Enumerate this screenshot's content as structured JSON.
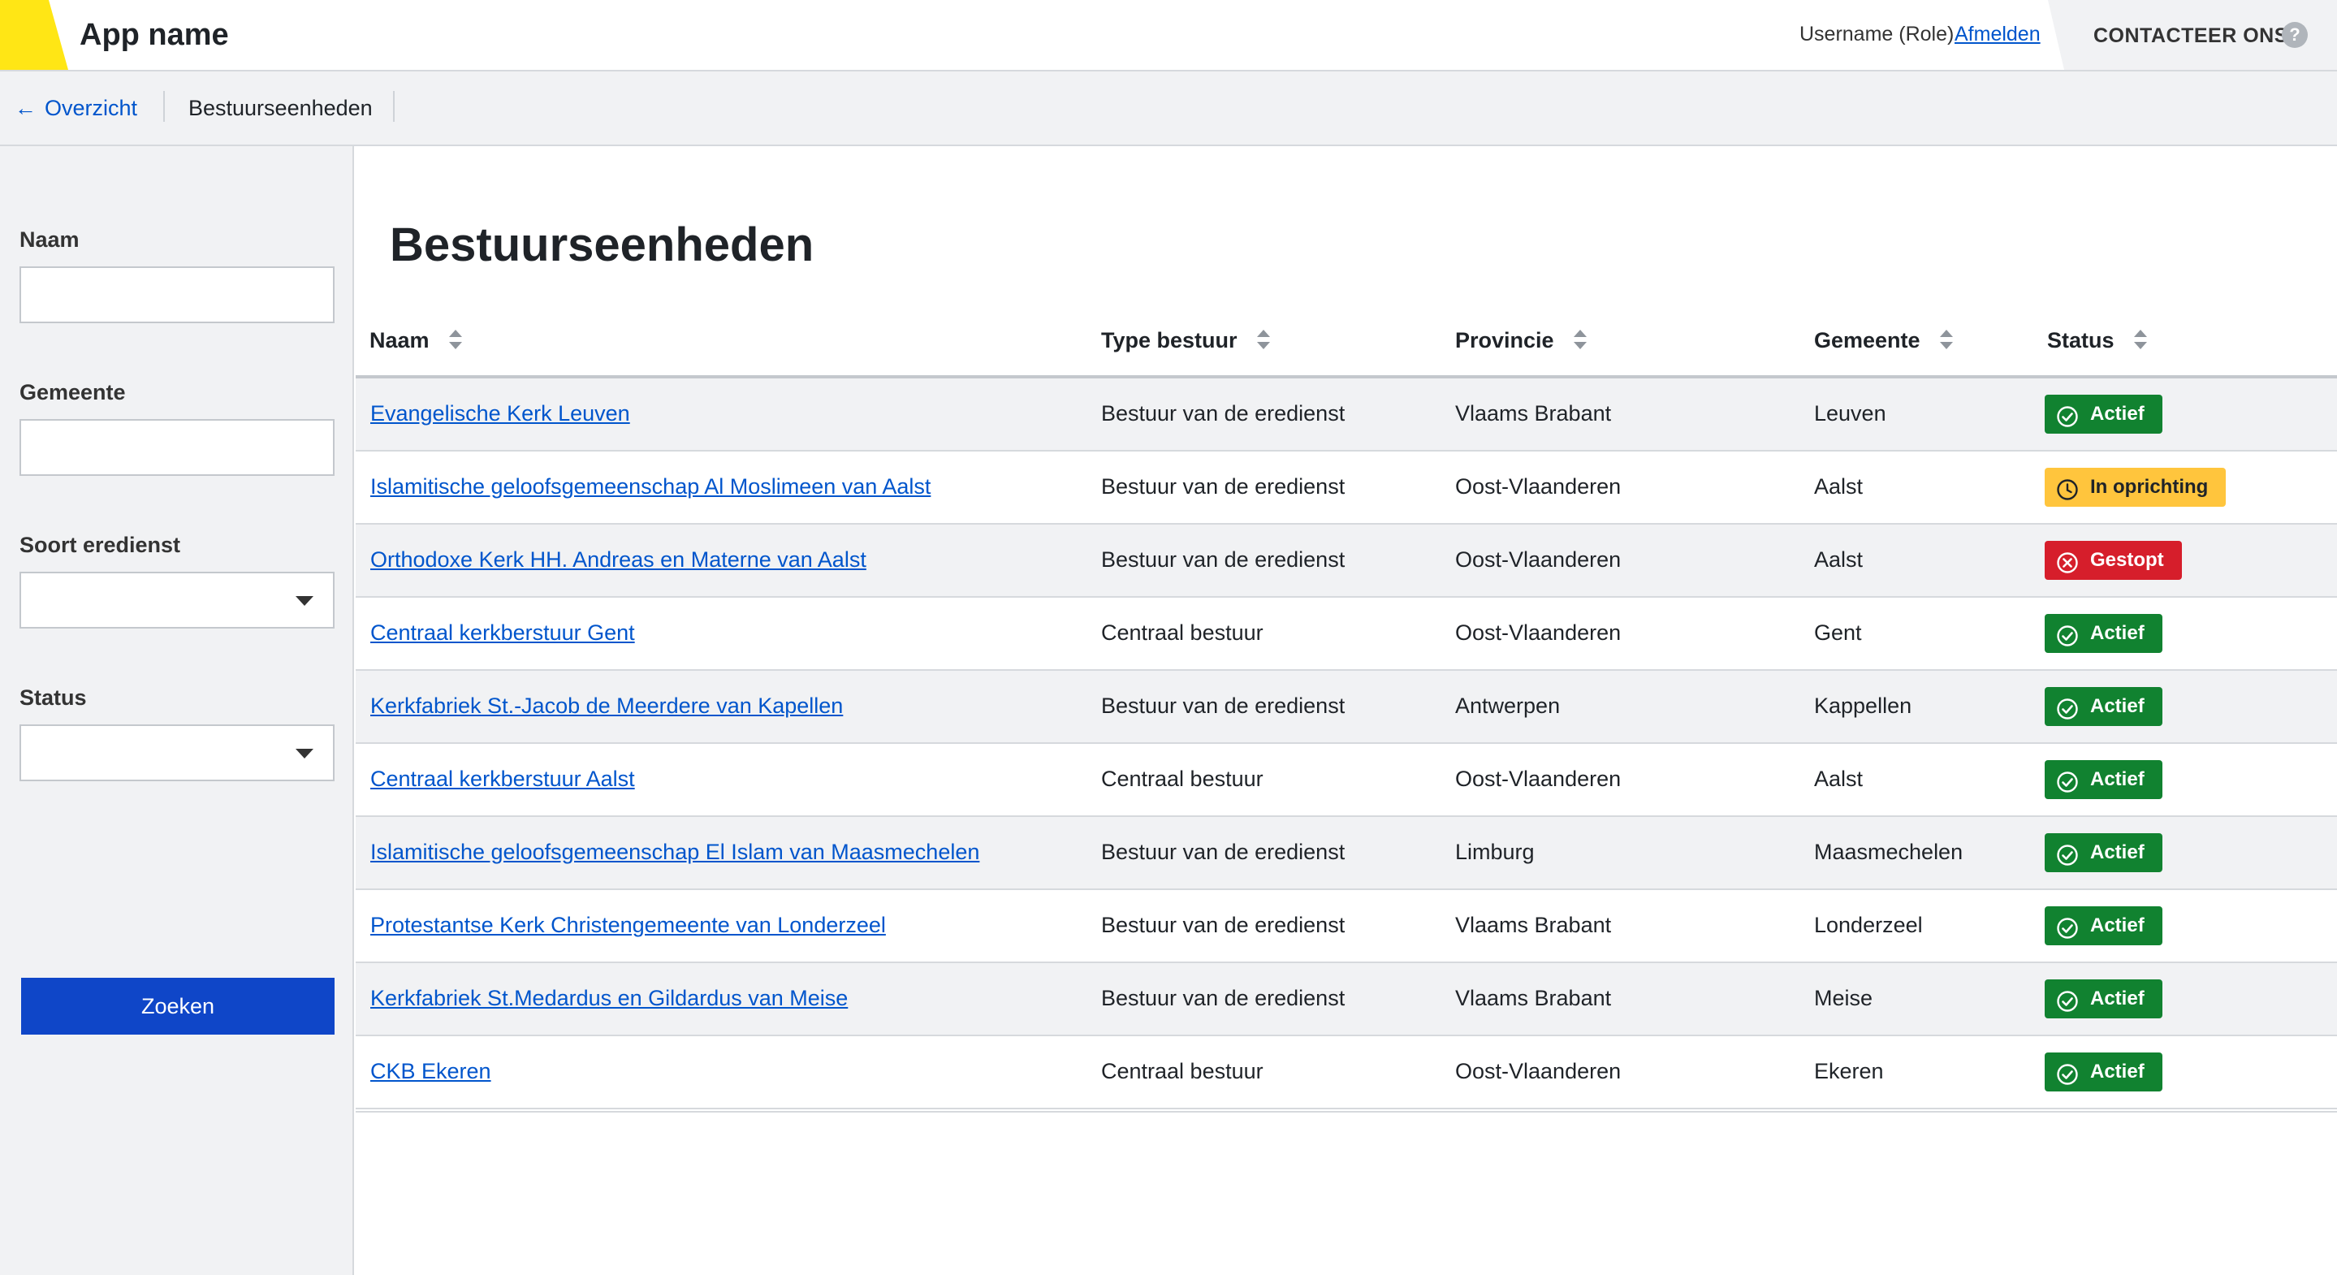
{
  "header": {
    "app_name": "App name",
    "user": "Username (Role)",
    "logout": "Afmelden",
    "contact": "CONTACTEER ONS",
    "help_glyph": "?"
  },
  "breadcrumb": {
    "back_arrow": "←",
    "back_label": "Overzicht",
    "current": "Bestuurseenheden"
  },
  "filters": {
    "naam_label": "Naam",
    "naam_value": "",
    "gemeente_label": "Gemeente",
    "gemeente_value": "",
    "soort_label": "Soort eredienst",
    "soort_value": "",
    "status_label": "Status",
    "status_value": "",
    "search_label": "Zoeken"
  },
  "main": {
    "title": "Bestuurseenheden",
    "columns": [
      "Naam",
      "Type bestuur",
      "Provincie",
      "Gemeente",
      "Status"
    ],
    "rows": [
      {
        "naam": "Evangelische Kerk Leuven",
        "type": "Bestuur van de eredienst",
        "provincie": "Vlaams Brabant",
        "gemeente": "Leuven",
        "status": "Actief"
      },
      {
        "naam": "Islamitische geloofsgemeenschap Al Moslimeen van Aalst",
        "type": "Bestuur van de eredienst",
        "provincie": "Oost-Vlaanderen",
        "gemeente": "Aalst",
        "status": "In oprichting"
      },
      {
        "naam": "Orthodoxe Kerk HH. Andreas en Materne van Aalst",
        "type": "Bestuur van de eredienst",
        "provincie": "Oost-Vlaanderen",
        "gemeente": "Aalst",
        "status": "Gestopt"
      },
      {
        "naam": "Centraal kerkberstuur Gent",
        "type": "Centraal bestuur",
        "provincie": "Oost-Vlaanderen",
        "gemeente": "Gent",
        "status": "Actief"
      },
      {
        "naam": "Kerkfabriek St.-Jacob de Meerdere van Kapellen",
        "type": "Bestuur van de eredienst",
        "provincie": "Antwerpen",
        "gemeente": "Kappellen",
        "status": "Actief"
      },
      {
        "naam": "Centraal kerkberstuur Aalst",
        "type": "Centraal bestuur",
        "provincie": "Oost-Vlaanderen",
        "gemeente": "Aalst",
        "status": "Actief"
      },
      {
        "naam": "Islamitische geloofsgemeenschap El Islam van Maasmechelen",
        "type": "Bestuur van de eredienst",
        "provincie": "Limburg",
        "gemeente": "Maasmechelen",
        "status": "Actief"
      },
      {
        "naam": "Protestantse Kerk Christengemeente van Londerzeel",
        "type": "Bestuur van de eredienst",
        "provincie": "Vlaams Brabant",
        "gemeente": "Londerzeel",
        "status": "Actief"
      },
      {
        "naam": "Kerkfabriek St.Medardus en Gildardus van Meise",
        "type": "Bestuur van de eredienst",
        "provincie": "Vlaams Brabant",
        "gemeente": "Meise",
        "status": "Actief"
      },
      {
        "naam": "CKB Ekeren",
        "type": "Centraal bestuur",
        "provincie": "Oost-Vlaanderen",
        "gemeente": "Ekeren",
        "status": "Actief"
      }
    ]
  },
  "colors": {
    "accent_yellow": "#ffe615",
    "link": "#0055cc",
    "button": "#0f46c8",
    "status_actief": "#118230",
    "status_oprichting": "#ffc53d",
    "status_gestopt": "#d61e2b"
  },
  "icons": {
    "actief": "check-circle-icon",
    "oprichting": "clock-icon",
    "gestopt": "x-circle-icon",
    "sort": "sort-icon",
    "help": "help-icon",
    "back": "arrow-left-icon",
    "select": "chevron-down-icon"
  }
}
